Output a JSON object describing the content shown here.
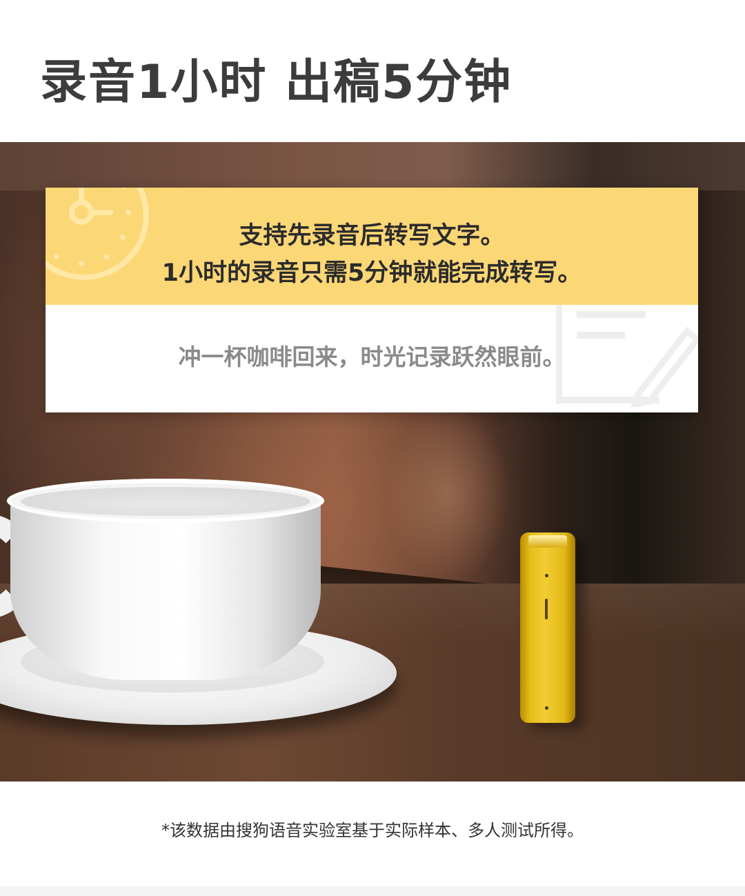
{
  "headline": "录音1小时  出稿5分钟",
  "card": {
    "line1": "支持先录音后转写文字。",
    "line2": "1小时的录音只需5分钟就能完成转写。",
    "line3": "冲一杯咖啡回来，时光记录跃然眼前。"
  },
  "footnote": "*该数据由搜狗语音实验室基于实际样本、多人测试所得。",
  "colors": {
    "card_yellow": "#fcd776",
    "device_yellow": "#f1cd33",
    "headline_text": "#3c3c3c",
    "secondary_text": "#8a8a8a"
  },
  "icons": [
    "clock-icon",
    "document-edit-icon"
  ]
}
